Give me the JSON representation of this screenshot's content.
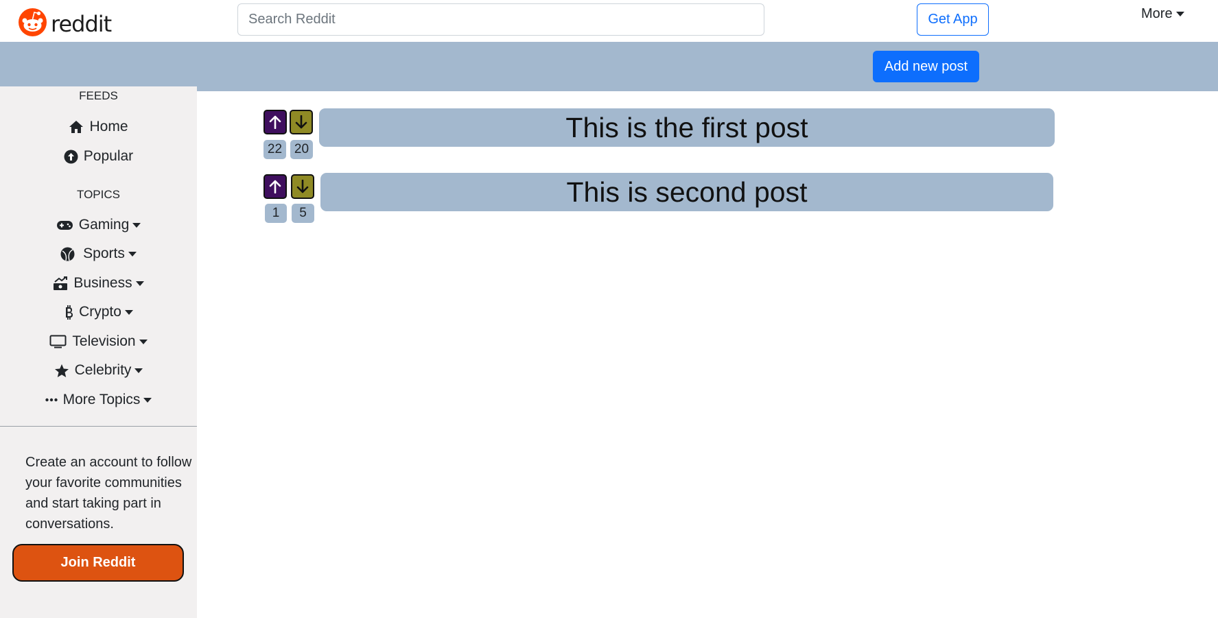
{
  "header": {
    "logo_text": "reddit",
    "search_placeholder": "Search Reddit",
    "get_app_label": "Get App",
    "more_label": "More"
  },
  "toolbar": {
    "add_post_label": "Add new post"
  },
  "sidebar": {
    "feeds_title": "FEEDS",
    "feeds": [
      {
        "label": "Home",
        "icon": "home-icon"
      },
      {
        "label": "Popular",
        "icon": "popular-icon"
      }
    ],
    "topics_title": "TOPICS",
    "topics": [
      {
        "label": "Gaming",
        "icon": "gamepad-icon"
      },
      {
        "label": "Sports",
        "icon": "ball-icon"
      },
      {
        "label": "Business",
        "icon": "business-icon"
      },
      {
        "label": "Crypto",
        "icon": "bitcoin-icon"
      },
      {
        "label": "Television",
        "icon": "tv-icon"
      },
      {
        "label": "Celebrity",
        "icon": "star-icon"
      },
      {
        "label": "More Topics",
        "icon": "ellipsis-icon"
      }
    ],
    "promo_text": "Create an account to follow your favorite communities and start taking part in conversations.",
    "join_label": "Join Reddit"
  },
  "posts": [
    {
      "title": "This is the first post",
      "upvotes": "22",
      "downvotes": "20"
    },
    {
      "title": "This is second post",
      "upvotes": "1",
      "downvotes": "5"
    }
  ],
  "colors": {
    "accent_blue": "#0d6efd",
    "bar_blue": "#a3b8ce",
    "upvote": "#3f0f5e",
    "downvote": "#8f8a25",
    "join": "#dd5311",
    "reddit_orange": "#ff4500"
  }
}
